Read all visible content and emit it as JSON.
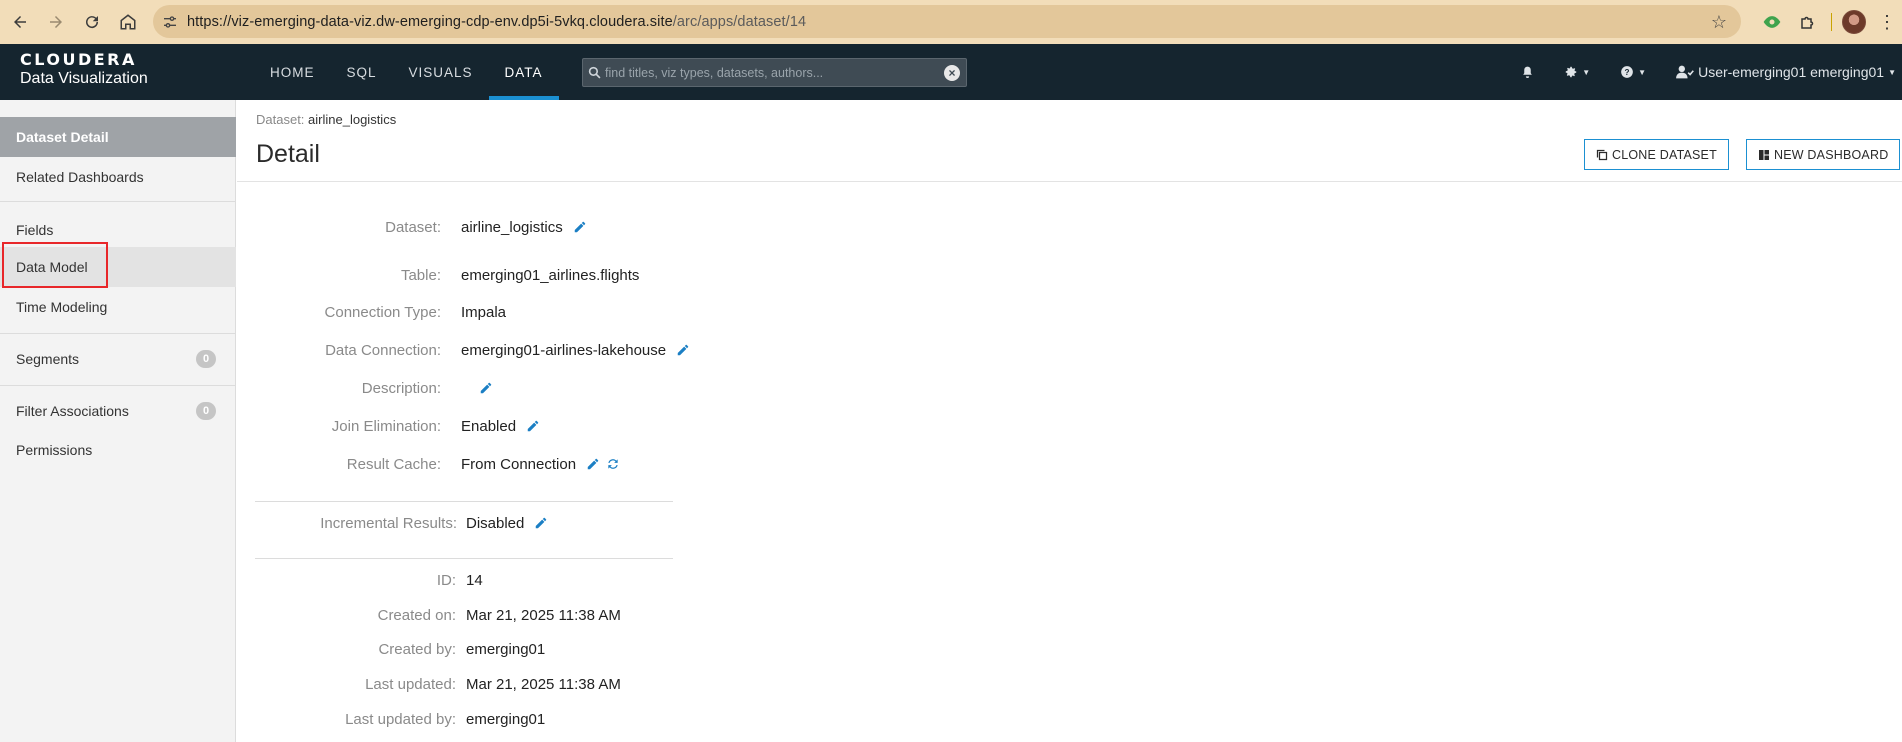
{
  "browser": {
    "url_main": "https://viz-emerging-data-viz.dw-emerging-cdp-env.dp5i-5vkq.cloudera.site",
    "url_path": "/arc/apps/dataset/14"
  },
  "app": {
    "brand_line1": "CLOUDERA",
    "brand_line2": "Data Visualization",
    "nav": [
      {
        "label": "HOME"
      },
      {
        "label": "SQL"
      },
      {
        "label": "VISUALS"
      },
      {
        "label": "DATA"
      }
    ],
    "search_placeholder": "find titles, viz types, datasets, authors...",
    "user_label": "User-emerging01 emerging01"
  },
  "sidebar": {
    "items": [
      {
        "label": "Dataset Detail"
      },
      {
        "label": "Related Dashboards"
      },
      {
        "label": "Fields"
      },
      {
        "label": "Data Model"
      },
      {
        "label": "Time Modeling"
      },
      {
        "label": "Segments",
        "count": "0"
      },
      {
        "label": "Filter Associations",
        "count": "0"
      },
      {
        "label": "Permissions"
      }
    ]
  },
  "page": {
    "breadcrumb_label": "Dataset:",
    "breadcrumb_value": "airline_logistics",
    "title": "Detail",
    "clone_button": "CLONE DATASET",
    "new_dashboard_button": "NEW DASHBOARD"
  },
  "details": {
    "dataset": {
      "label": "Dataset:",
      "value": "airline_logistics"
    },
    "table": {
      "label": "Table:",
      "value": "emerging01_airlines.flights"
    },
    "connection_type": {
      "label": "Connection Type:",
      "value": "Impala"
    },
    "data_connection": {
      "label": "Data Connection:",
      "value": "emerging01-airlines-lakehouse"
    },
    "description": {
      "label": "Description:",
      "value": ""
    },
    "join_elimination": {
      "label": "Join Elimination:",
      "value": "Enabled"
    },
    "result_cache": {
      "label": "Result Cache:",
      "value": "From Connection"
    },
    "incremental_results": {
      "label": "Incremental Results:",
      "value": "Disabled"
    },
    "id": {
      "label": "ID:",
      "value": "14"
    },
    "created_on": {
      "label": "Created on:",
      "value": "Mar 21, 2025 11:38 AM"
    },
    "created_by": {
      "label": "Created by:",
      "value": "emerging01"
    },
    "last_updated": {
      "label": "Last updated:",
      "value": "Mar 21, 2025 11:38 AM"
    },
    "last_updated_by": {
      "label": "Last updated by:",
      "value": "emerging01"
    }
  },
  "colors": {
    "accent": "#1b90d2",
    "header_bg": "#15252f",
    "highlight_box": "#e8272a"
  },
  "icons": [
    "back-icon",
    "forward-icon",
    "reload-icon",
    "home-icon",
    "site-info-icon",
    "star-icon",
    "extension-icon",
    "puzzle-icon",
    "menu-dots-icon",
    "search-icon",
    "clear-icon",
    "bell-icon",
    "gear-icon",
    "help-icon",
    "user-icon",
    "pencil-icon",
    "refresh-icon",
    "clone-icon",
    "dashboard-icon"
  ]
}
